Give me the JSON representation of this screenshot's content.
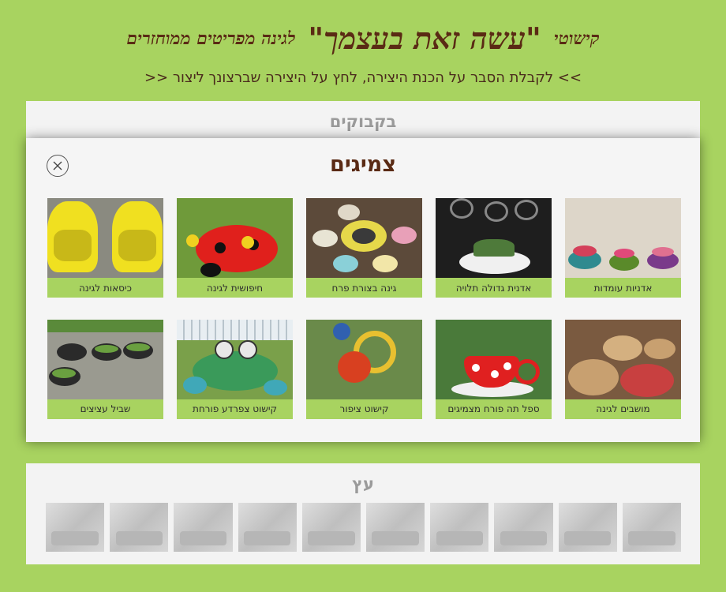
{
  "header": {
    "title_prefix": "קישוטי",
    "title_main": "\"עשה זאת בעצמך\"",
    "title_suffix": "לגינה מפריטים ממוחזרים",
    "subtitle": ">> לקבלת הסבר על הכנת היצירה, לחץ על היצירה שברצונך ליצור <<"
  },
  "categories": {
    "bottles": "בקבוקים",
    "wood": "עץ"
  },
  "modal": {
    "title": "צמיגים",
    "close_icon": "close-icon",
    "items": [
      {
        "caption": "אדניות עומדות",
        "icon": "tire-planters-photo"
      },
      {
        "caption": "אדנית גדולה תלויה",
        "icon": "hanging-planter-photo"
      },
      {
        "caption": "גינה בצורת פרח",
        "icon": "flower-garden-photo"
      },
      {
        "caption": "חיפושית לגינה",
        "icon": "ladybug-photo"
      },
      {
        "caption": "כיסאות לגינה",
        "icon": "tire-chairs-photo"
      },
      {
        "caption": "מושבים לגינה",
        "icon": "tire-seats-photo"
      },
      {
        "caption": "ספל תה פורח מצמיגים",
        "icon": "teacup-photo"
      },
      {
        "caption": "קישוט ציפור",
        "icon": "bird-photo"
      },
      {
        "caption": "קישוט צפרדע פורחת",
        "icon": "frog-photo"
      },
      {
        "caption": "שביל עציצים",
        "icon": "path-photo"
      }
    ]
  },
  "colors": {
    "background": "#a8d360",
    "title_brown": "#5a2a14",
    "caption_bg": "#a8d360"
  }
}
